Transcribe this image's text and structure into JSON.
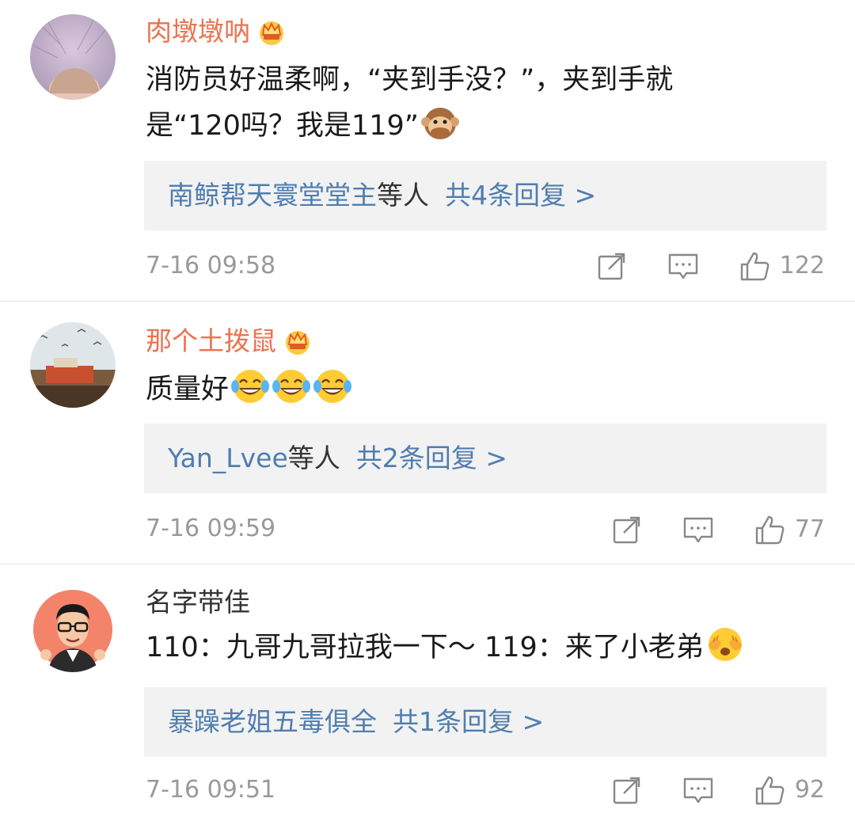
{
  "comments": [
    {
      "username": "肉墩墩呐",
      "vip": true,
      "text_lines": [
        "消防员好温柔啊，“夹到手没？”，夹到手就",
        "是“120吗？我是119”"
      ],
      "reply_names": "南鲸帮天寰堂堂主",
      "reply_others": "等人",
      "reply_count": "共4条回复 >",
      "time": "7-16 09:58",
      "likes": "122",
      "emoji_icons": [
        "monkey-emoji"
      ]
    },
    {
      "username": "那个土拨鼠",
      "vip": true,
      "text": "质量好",
      "reply_names": "Yan_Lvee",
      "reply_others": "等人",
      "reply_count": "共2条回复 >",
      "time": "7-16 09:59",
      "likes": "77",
      "emoji_icons": [
        "laugh-cry-emoji",
        "laugh-cry-emoji",
        "laugh-cry-emoji"
      ]
    },
    {
      "username": "名字带佳",
      "vip": false,
      "text": "110：九哥九哥拉我一下～ 119：来了小老弟",
      "reply_names": "暴躁老姐五毒俱全",
      "reply_others": "",
      "reply_count": "共1条回复 >",
      "time": "7-16 09:51",
      "likes": "92",
      "emoji_icons": [
        "cover-face-emoji"
      ]
    }
  ],
  "icons": {
    "share": "share-icon",
    "comment": "comment-icon",
    "like": "thumbs-up-icon",
    "vip": "crown-icon"
  },
  "colors": {
    "vip_name": "#eb7350",
    "link": "#507daf",
    "muted": "#999999",
    "reply_bg": "#f2f2f2"
  }
}
